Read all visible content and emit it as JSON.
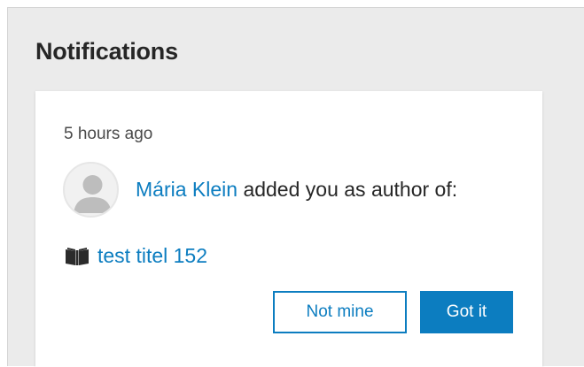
{
  "panel": {
    "title": "Notifications"
  },
  "notification": {
    "timestamp": "5 hours ago",
    "avatar_icon": "user-avatar-icon",
    "author_name": "Mária Klein",
    "message": "added you as author of:",
    "document_icon": "book-icon",
    "document_title": "test titel 152",
    "actions": {
      "reject_label": "Not mine",
      "accept_label": "Got it"
    }
  },
  "colors": {
    "accent": "#0c7dc0",
    "panel_background": "#ebebeb",
    "card_background": "#ffffff",
    "text": "#262626"
  }
}
